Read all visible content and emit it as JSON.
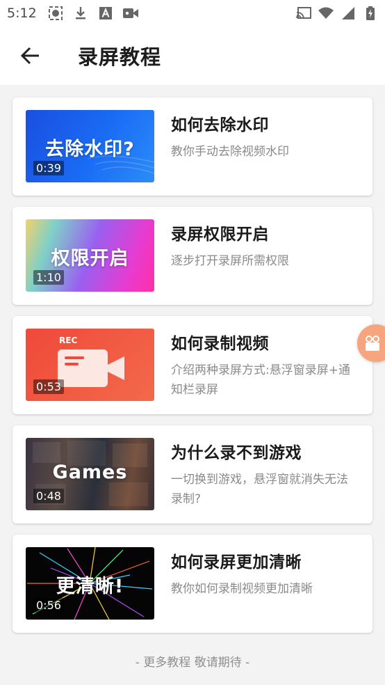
{
  "status_bar": {
    "time": "5:12"
  },
  "header": {
    "title": "录屏教程"
  },
  "tutorials": [
    {
      "thumb_text": "去除水印?",
      "duration": "0:39",
      "title": "如何去除水印",
      "desc": "教你手动去除视频水印"
    },
    {
      "thumb_text": "权限开启",
      "duration": "1:10",
      "title": "录屏权限开启",
      "desc": "逐步打开录屏所需权限"
    },
    {
      "thumb_text": "REC",
      "duration": "0:53",
      "title": "如何录制视频",
      "desc": "介绍两种录屏方式:悬浮窗录屏+通知栏录屏"
    },
    {
      "thumb_text": "Games",
      "duration": "0:48",
      "title": "为什么录不到游戏",
      "desc": "一切换到游戏，悬浮窗就消失无法录制?"
    },
    {
      "thumb_text": "更清晰!",
      "duration": "0:56",
      "title": "如何录屏更加清晰",
      "desc": "教你如何录制视频更加清晰"
    }
  ],
  "footer": {
    "note": "- 更多教程 敬请期待 -"
  },
  "icons": {
    "status_left": [
      "screen-record-icon",
      "download-icon",
      "text-a-icon",
      "video-camera-icon"
    ],
    "status_right": [
      "cast-icon",
      "wifi-icon",
      "signal-icon",
      "battery-charging-icon"
    ],
    "back": "arrow-left-icon",
    "floating": "camera-recorder-icon"
  },
  "colors": {
    "accent_blue": "#1a6cf5",
    "accent_red": "#f1553c",
    "floating": "#f7a57e"
  }
}
